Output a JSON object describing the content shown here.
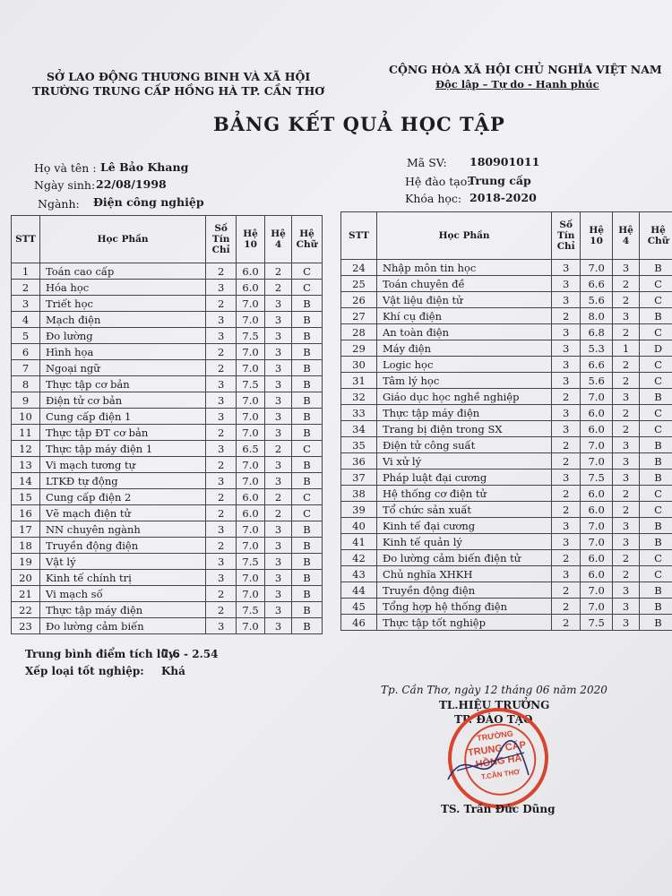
{
  "header": {
    "left_line1": "SỞ LAO ĐỘNG THƯƠNG BINH VÀ XÃ HỘI",
    "left_line2": "TRƯỜNG TRUNG CẤP HỒNG HÀ TP. CẦN THƠ",
    "right_line1": "CỘNG HÒA XÃ HỘI CHỦ NGHĨA VIỆT NAM",
    "right_line2": "Độc lập – Tự do - Hạnh phúc"
  },
  "title": "BẢNG KẾT QUẢ HỌC TẬP",
  "student": {
    "name_label": "Họ và tên :",
    "name": "Lê Bảo Khang",
    "dob_label": "Ngày sinh:",
    "dob": "22/08/1998",
    "major_label": "Ngành:",
    "major": "Điện công nghiệp",
    "id_label": "Mã SV:",
    "id": "180901011",
    "program_label": "Hệ đào tạo:",
    "program": "Trung cấp",
    "course_label": "Khóa học:",
    "course": "2018-2020"
  },
  "table_headers": {
    "stt": "STT",
    "subject": "Học Phần",
    "credits": "Số Tín Chỉ",
    "grade10": "Hệ 10",
    "grade4": "Hệ 4",
    "letter": "Hệ Chữ"
  },
  "left_rows": [
    {
      "stt": "1",
      "name": "Toán cao cấp",
      "tc": "2",
      "h10": "6.0",
      "h4": "2",
      "chu": "C"
    },
    {
      "stt": "2",
      "name": "Hóa học",
      "tc": "3",
      "h10": "6.0",
      "h4": "2",
      "chu": "C"
    },
    {
      "stt": "3",
      "name": "Triết học",
      "tc": "2",
      "h10": "7.0",
      "h4": "3",
      "chu": "B"
    },
    {
      "stt": "4",
      "name": "Mạch điện",
      "tc": "3",
      "h10": "7.0",
      "h4": "3",
      "chu": "B"
    },
    {
      "stt": "5",
      "name": "Đo lường",
      "tc": "3",
      "h10": "7.5",
      "h4": "3",
      "chu": "B"
    },
    {
      "stt": "6",
      "name": "Hình họa",
      "tc": "2",
      "h10": "7.0",
      "h4": "3",
      "chu": "B"
    },
    {
      "stt": "7",
      "name": "Ngoại ngữ",
      "tc": "2",
      "h10": "7.0",
      "h4": "3",
      "chu": "B"
    },
    {
      "stt": "8",
      "name": "Thực tập cơ bản",
      "tc": "3",
      "h10": "7.5",
      "h4": "3",
      "chu": "B"
    },
    {
      "stt": "9",
      "name": "Điện tử cơ bản",
      "tc": "3",
      "h10": "7.0",
      "h4": "3",
      "chu": "B"
    },
    {
      "stt": "10",
      "name": "Cung cấp điện 1",
      "tc": "3",
      "h10": "7.0",
      "h4": "3",
      "chu": "B"
    },
    {
      "stt": "11",
      "name": "Thực tập ĐT cơ bản",
      "tc": "2",
      "h10": "7.0",
      "h4": "3",
      "chu": "B"
    },
    {
      "stt": "12",
      "name": "Thực tập máy điện 1",
      "tc": "3",
      "h10": "6.5",
      "h4": "2",
      "chu": "C"
    },
    {
      "stt": "13",
      "name": "Vi mạch tương tự",
      "tc": "2",
      "h10": "7.0",
      "h4": "3",
      "chu": "B"
    },
    {
      "stt": "14",
      "name": "LTKĐ tự động",
      "tc": "3",
      "h10": "7.0",
      "h4": "3",
      "chu": "B"
    },
    {
      "stt": "15",
      "name": "Cung cấp điện 2",
      "tc": "2",
      "h10": "6.0",
      "h4": "2",
      "chu": "C"
    },
    {
      "stt": "16",
      "name": "Vẽ mạch điện tử",
      "tc": "2",
      "h10": "6.0",
      "h4": "2",
      "chu": "C"
    },
    {
      "stt": "17",
      "name": "NN chuyên ngành",
      "tc": "3",
      "h10": "7.0",
      "h4": "3",
      "chu": "B"
    },
    {
      "stt": "18",
      "name": "Truyền động điện",
      "tc": "2",
      "h10": "7.0",
      "h4": "3",
      "chu": "B"
    },
    {
      "stt": "19",
      "name": "Vật lý",
      "tc": "3",
      "h10": "7.5",
      "h4": "3",
      "chu": "B"
    },
    {
      "stt": "20",
      "name": "Kinh tế chính trị",
      "tc": "3",
      "h10": "7.0",
      "h4": "3",
      "chu": "B"
    },
    {
      "stt": "21",
      "name": "Vi mạch số",
      "tc": "2",
      "h10": "7.0",
      "h4": "3",
      "chu": "B"
    },
    {
      "stt": "22",
      "name": "Thực tập máy điện",
      "tc": "2",
      "h10": "7.5",
      "h4": "3",
      "chu": "B"
    },
    {
      "stt": "23",
      "name": "Đo lường cảm biến",
      "tc": "3",
      "h10": "7.0",
      "h4": "3",
      "chu": "B"
    }
  ],
  "right_rows": [
    {
      "stt": "24",
      "name": "Nhập môn tin học",
      "tc": "3",
      "h10": "7.0",
      "h4": "3",
      "chu": "B"
    },
    {
      "stt": "25",
      "name": "Toán chuyên đề",
      "tc": "3",
      "h10": "6.6",
      "h4": "2",
      "chu": "C"
    },
    {
      "stt": "26",
      "name": "Vật liệu điện tử",
      "tc": "3",
      "h10": "5.6",
      "h4": "2",
      "chu": "C"
    },
    {
      "stt": "27",
      "name": "Khí cụ điện",
      "tc": "2",
      "h10": "8.0",
      "h4": "3",
      "chu": "B"
    },
    {
      "stt": "28",
      "name": "An toàn điện",
      "tc": "3",
      "h10": "6.8",
      "h4": "2",
      "chu": "C"
    },
    {
      "stt": "29",
      "name": "Máy điện",
      "tc": "3",
      "h10": "5.3",
      "h4": "1",
      "chu": "D"
    },
    {
      "stt": "30",
      "name": "Logic học",
      "tc": "3",
      "h10": "6.6",
      "h4": "2",
      "chu": "C"
    },
    {
      "stt": "31",
      "name": "Tâm lý học",
      "tc": "3",
      "h10": "5.6",
      "h4": "2",
      "chu": "C"
    },
    {
      "stt": "32",
      "name": "Giáo dục học nghề nghiệp",
      "tc": "2",
      "h10": "7.0",
      "h4": "3",
      "chu": "B"
    },
    {
      "stt": "33",
      "name": "Thực tập máy điện",
      "tc": "3",
      "h10": "6.0",
      "h4": "2",
      "chu": "C"
    },
    {
      "stt": "34",
      "name": "Trang bị điện trong SX",
      "tc": "3",
      "h10": "6.0",
      "h4": "2",
      "chu": "C"
    },
    {
      "stt": "35",
      "name": "Điện tử công suất",
      "tc": "2",
      "h10": "7.0",
      "h4": "3",
      "chu": "B"
    },
    {
      "stt": "36",
      "name": "Vi xử lý",
      "tc": "2",
      "h10": "7.0",
      "h4": "3",
      "chu": "B"
    },
    {
      "stt": "37",
      "name": "Pháp luật đại cương",
      "tc": "3",
      "h10": "7.5",
      "h4": "3",
      "chu": "B"
    },
    {
      "stt": "38",
      "name": "Hệ thống cơ điện tử",
      "tc": "2",
      "h10": "6.0",
      "h4": "2",
      "chu": "C"
    },
    {
      "stt": "39",
      "name": "Tổ chức sản xuất",
      "tc": "2",
      "h10": "6.0",
      "h4": "2",
      "chu": "C"
    },
    {
      "stt": "40",
      "name": "Kinh tế đại cương",
      "tc": "3",
      "h10": "7.0",
      "h4": "3",
      "chu": "B"
    },
    {
      "stt": "41",
      "name": "Kinh tế quản lý",
      "tc": "3",
      "h10": "7.0",
      "h4": "3",
      "chu": "B"
    },
    {
      "stt": "42",
      "name": "Đo lường cảm biến điện tử",
      "tc": "2",
      "h10": "6.0",
      "h4": "2",
      "chu": "C"
    },
    {
      "stt": "43",
      "name": "Chủ nghĩa XHKH",
      "tc": "3",
      "h10": "6.0",
      "h4": "2",
      "chu": "C"
    },
    {
      "stt": "44",
      "name": "Truyền động điện",
      "tc": "2",
      "h10": "7.0",
      "h4": "3",
      "chu": "B"
    },
    {
      "stt": "45",
      "name": "Tổng hợp hệ thống điện",
      "tc": "2",
      "h10": "7.0",
      "h4": "3",
      "chu": "B"
    },
    {
      "stt": "46",
      "name": "Thực tập tốt nghiệp",
      "tc": "2",
      "h10": "7.5",
      "h4": "3",
      "chu": "B"
    }
  ],
  "summary": {
    "gpa_label": "Trung bình điểm tích lũy:",
    "gpa": "7.6 - 2.54",
    "rank_label": "Xếp loại tốt nghiệp:",
    "rank": "Khá"
  },
  "signature": {
    "place_date": "Tp. Cần Thơ, ngày 12 tháng 06 năm 2020",
    "role1": "TL.HIỆU TRƯỞNG",
    "role2": "TP. ĐÀO TẠO",
    "signer": "TS. Trần Đức Dũng"
  },
  "stamp": {
    "line1": "TRƯỜNG",
    "line2": "TRUNG CẤP",
    "line3": "HỒNG HÀ",
    "line4": "T.CẦN THƠ",
    "color": "#d9442f"
  }
}
